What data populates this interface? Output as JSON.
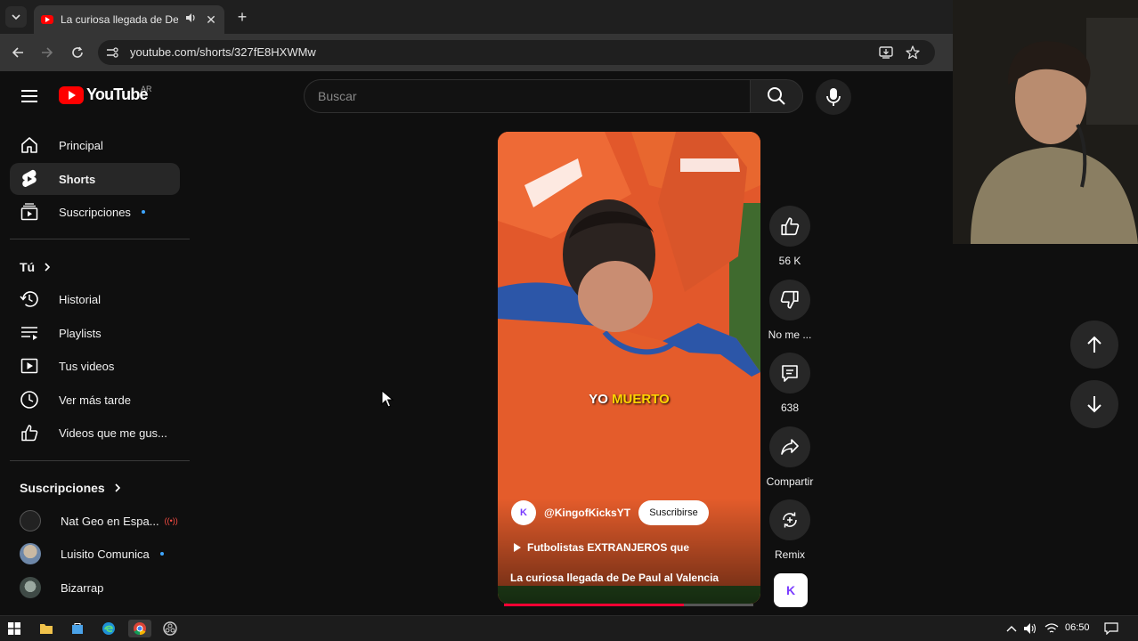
{
  "browser": {
    "tab_title": "La curiosa llegada de De Paul al Valencia",
    "new_tab_label": "+",
    "close_label": "✕",
    "url": "youtube.com/shorts/327fE8HXWMw"
  },
  "youtube": {
    "logo_text": "YouTube",
    "country": "AR",
    "search_placeholder": "Buscar"
  },
  "sidebar": {
    "main": [
      {
        "label": "Principal",
        "icon": "home-icon"
      },
      {
        "label": "Shorts",
        "icon": "shorts-icon",
        "active": true
      },
      {
        "label": "Suscripciones",
        "icon": "subscriptions-icon",
        "dot": true
      }
    ],
    "you_heading": "Tú",
    "you": [
      {
        "label": "Historial",
        "icon": "history-icon"
      },
      {
        "label": "Playlists",
        "icon": "playlists-icon"
      },
      {
        "label": "Tus videos",
        "icon": "your-videos-icon"
      },
      {
        "label": "Ver más tarde",
        "icon": "watch-later-icon"
      },
      {
        "label": "Videos que me gus...",
        "icon": "liked-videos-icon"
      }
    ],
    "subs_heading": "Suscripciones",
    "subs": [
      {
        "label": "Nat Geo en Espa...",
        "live": true
      },
      {
        "label": "Luisito Comunica",
        "dot": true
      },
      {
        "label": "Bizarrap"
      }
    ]
  },
  "short": {
    "caption_a": "YO",
    "caption_b": "MUERTO",
    "channel_handle": "@KingofKicksYT",
    "channel_avatar_text": "K",
    "subscribe_label": "Suscribirse",
    "playlist_text": "Futbolistas EXTRANJEROS que",
    "title": "La curiosa llegada de De Paul al Valencia",
    "progress": 0.72
  },
  "actions": {
    "likes": "56 K",
    "dislike_label": "No me ...",
    "comments": "638",
    "share_label": "Compartir",
    "remix_label": "Remix",
    "sound_avatar_text": "K"
  },
  "taskbar": {
    "clock": "06:50"
  },
  "colors": {
    "brand_red": "#ff0000",
    "accent_blue": "#3ea6ff",
    "progress_red": "#ff0033",
    "jersey_orange": "#e4582a"
  }
}
